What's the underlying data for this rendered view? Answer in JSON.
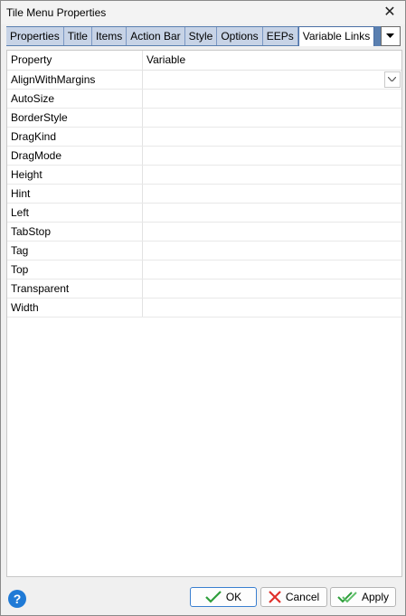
{
  "window": {
    "title": "Tile Menu Properties",
    "close_glyph": "✕"
  },
  "tabs": [
    {
      "label": "Properties"
    },
    {
      "label": "Title"
    },
    {
      "label": "Items"
    },
    {
      "label": "Action Bar"
    },
    {
      "label": "Style"
    },
    {
      "label": "Options"
    },
    {
      "label": "EEPs"
    },
    {
      "label": "Variable Links",
      "active": true
    }
  ],
  "grid": {
    "columns": [
      "Property",
      "Variable"
    ],
    "rows": [
      {
        "property": "AlignWithMargins",
        "variable": ""
      },
      {
        "property": "AutoSize",
        "variable": ""
      },
      {
        "property": "BorderStyle",
        "variable": ""
      },
      {
        "property": "DragKind",
        "variable": ""
      },
      {
        "property": "DragMode",
        "variable": ""
      },
      {
        "property": "Height",
        "variable": ""
      },
      {
        "property": "Hint",
        "variable": ""
      },
      {
        "property": "Left",
        "variable": ""
      },
      {
        "property": "TabStop",
        "variable": ""
      },
      {
        "property": "Tag",
        "variable": ""
      },
      {
        "property": "Top",
        "variable": ""
      },
      {
        "property": "Transparent",
        "variable": ""
      },
      {
        "property": "Width",
        "variable": ""
      }
    ]
  },
  "footer": {
    "help_glyph": "?",
    "ok_label": "OK",
    "cancel_label": "Cancel",
    "apply_label": "Apply"
  },
  "colors": {
    "tab_strip": "#5a7fb0",
    "tab_inactive": "#c7d3e6",
    "ok_check": "#2e9e3b",
    "cancel_x": "#e0302a",
    "help": "#1f7ad6"
  },
  "icons": {
    "close": "close-icon",
    "tab_menu": "chevron-down-icon",
    "dropdown": "chevron-down-icon",
    "help": "help-icon",
    "ok": "checkmark-icon",
    "cancel": "x-icon",
    "apply": "double-check-icon"
  }
}
